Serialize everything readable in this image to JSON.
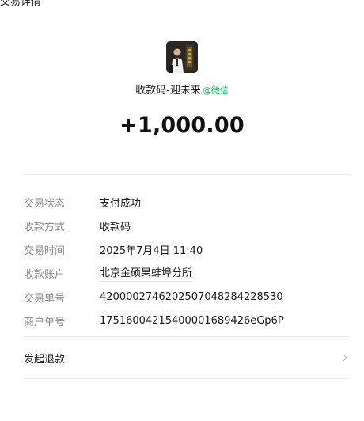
{
  "top_partial_text": "交易详情",
  "merchant": {
    "name": "收款码-迎未来",
    "platform_tag": "@微信"
  },
  "amount": "+1,000.00",
  "details": [
    {
      "label": "交易状态",
      "value": "支付成功"
    },
    {
      "label": "收款方式",
      "value": "收款码"
    },
    {
      "label": "交易时间",
      "value": "2025年7月4日 11:40"
    },
    {
      "label": "收款账户",
      "value": "北京金硕果蚌埠分所"
    },
    {
      "label": "交易单号",
      "value": "4200002746202507048284228530"
    },
    {
      "label": "商户单号",
      "value": "1751600421540000168942​6eGp6P"
    }
  ],
  "refund": {
    "label": "发起退款",
    "icon": "chevron-right-icon"
  },
  "colors": {
    "accent_green": "#07c160",
    "label_gray": "#8a8a8a",
    "divider": "#ececec"
  }
}
